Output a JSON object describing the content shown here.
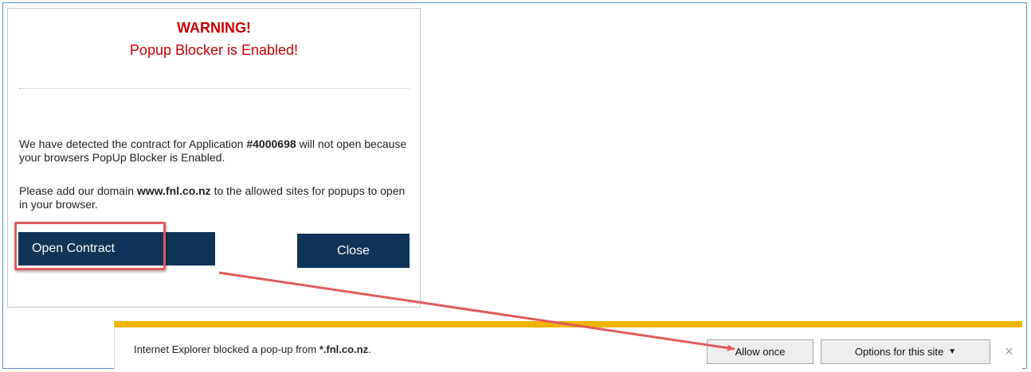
{
  "dialog": {
    "title": "WARNING!",
    "subtitle": "Popup Blocker is Enabled!",
    "p1_before": "We have detected the contract for Application ",
    "p1_bold": "#4000698",
    "p1_after": " will not open because your browsers PopUp Blocker is Enabled.",
    "p2_before": "Please add our domain ",
    "p2_bold": "www.fnl.co.nz",
    "p2_after": " to the allowed sites for popups to open in your browser.",
    "open_label": "Open Contract",
    "close_label": "Close"
  },
  "notification": {
    "text_before": "Internet Explorer blocked a pop-up from ",
    "domain": "*.fnl.co.nz",
    "text_after": ".",
    "allow_label": "Allow once",
    "options_label": "Options for this site",
    "options_icon": "caret-down-icon",
    "close_icon": "close-icon"
  },
  "colors": {
    "warning": "#cc0000",
    "button_bg": "#0d3457",
    "notif_bar": "#f0b400",
    "annotation": "#e05a5f"
  }
}
